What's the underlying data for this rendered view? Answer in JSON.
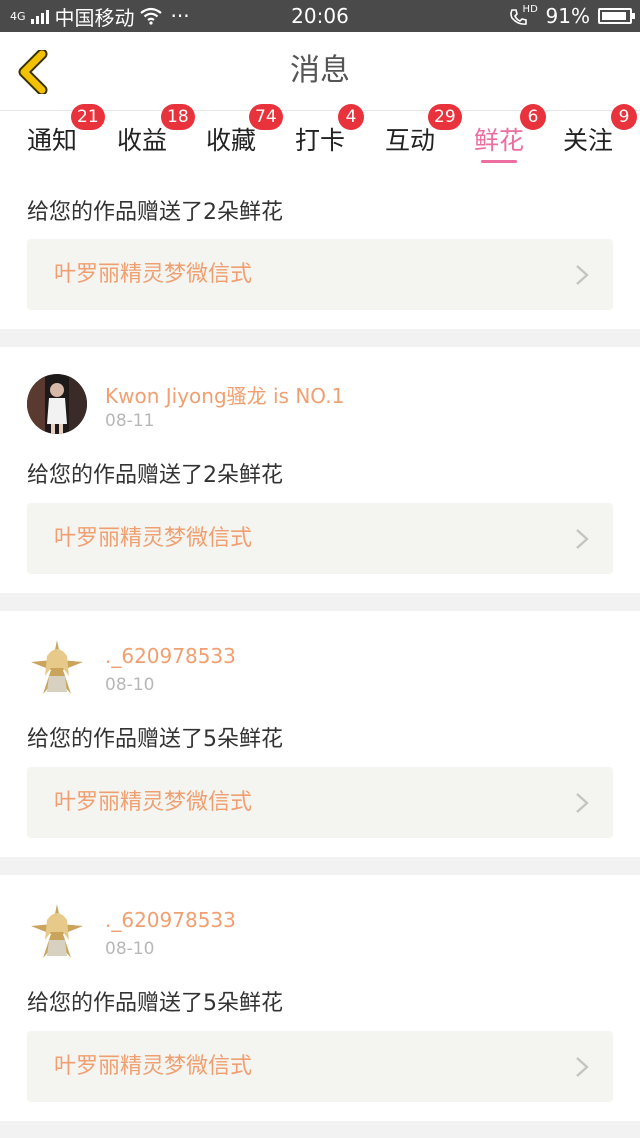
{
  "status_bar": {
    "network": "4G",
    "carrier": "中国移动",
    "more": "···",
    "time": "20:06",
    "hd_label": "HD",
    "battery_text": "91%",
    "battery_level": 0.91
  },
  "header": {
    "title": "消息"
  },
  "tabs": [
    {
      "label": "通知",
      "badge": "21",
      "active": false
    },
    {
      "label": "收益",
      "badge": "18",
      "active": false
    },
    {
      "label": "收藏",
      "badge": "74",
      "active": false
    },
    {
      "label": "打卡",
      "badge": "4",
      "active": false
    },
    {
      "label": "互动",
      "badge": "29",
      "active": false
    },
    {
      "label": "鲜花",
      "badge": "6",
      "active": true
    },
    {
      "label": "关注",
      "badge": "9",
      "active": false
    }
  ],
  "messages": [
    {
      "user": "",
      "date": "",
      "avatar_icon": "",
      "text": "给您的作品赠送了2朵鲜花",
      "work_title": "叶罗丽精灵梦微信式"
    },
    {
      "user": "Kwon Jiyong骚龙 is NO.1",
      "date": "08-11",
      "avatar_icon": "photo-avatar",
      "text": "给您的作品赠送了2朵鲜花",
      "work_title": "叶罗丽精灵梦微信式"
    },
    {
      "user": "._620978533",
      "date": "08-10",
      "avatar_icon": "star-girl-avatar",
      "text": "给您的作品赠送了5朵鲜花",
      "work_title": "叶罗丽精灵梦微信式"
    },
    {
      "user": "._620978533",
      "date": "08-10",
      "avatar_icon": "star-girl-avatar",
      "text": "给您的作品赠送了5朵鲜花",
      "work_title": "叶罗丽精灵梦微信式"
    }
  ],
  "colors": {
    "accent_pink": "#ec6ea0",
    "badge_red": "#e8323c",
    "username_orange": "#f0a070",
    "back_arrow_yellow": "#f2c200"
  }
}
